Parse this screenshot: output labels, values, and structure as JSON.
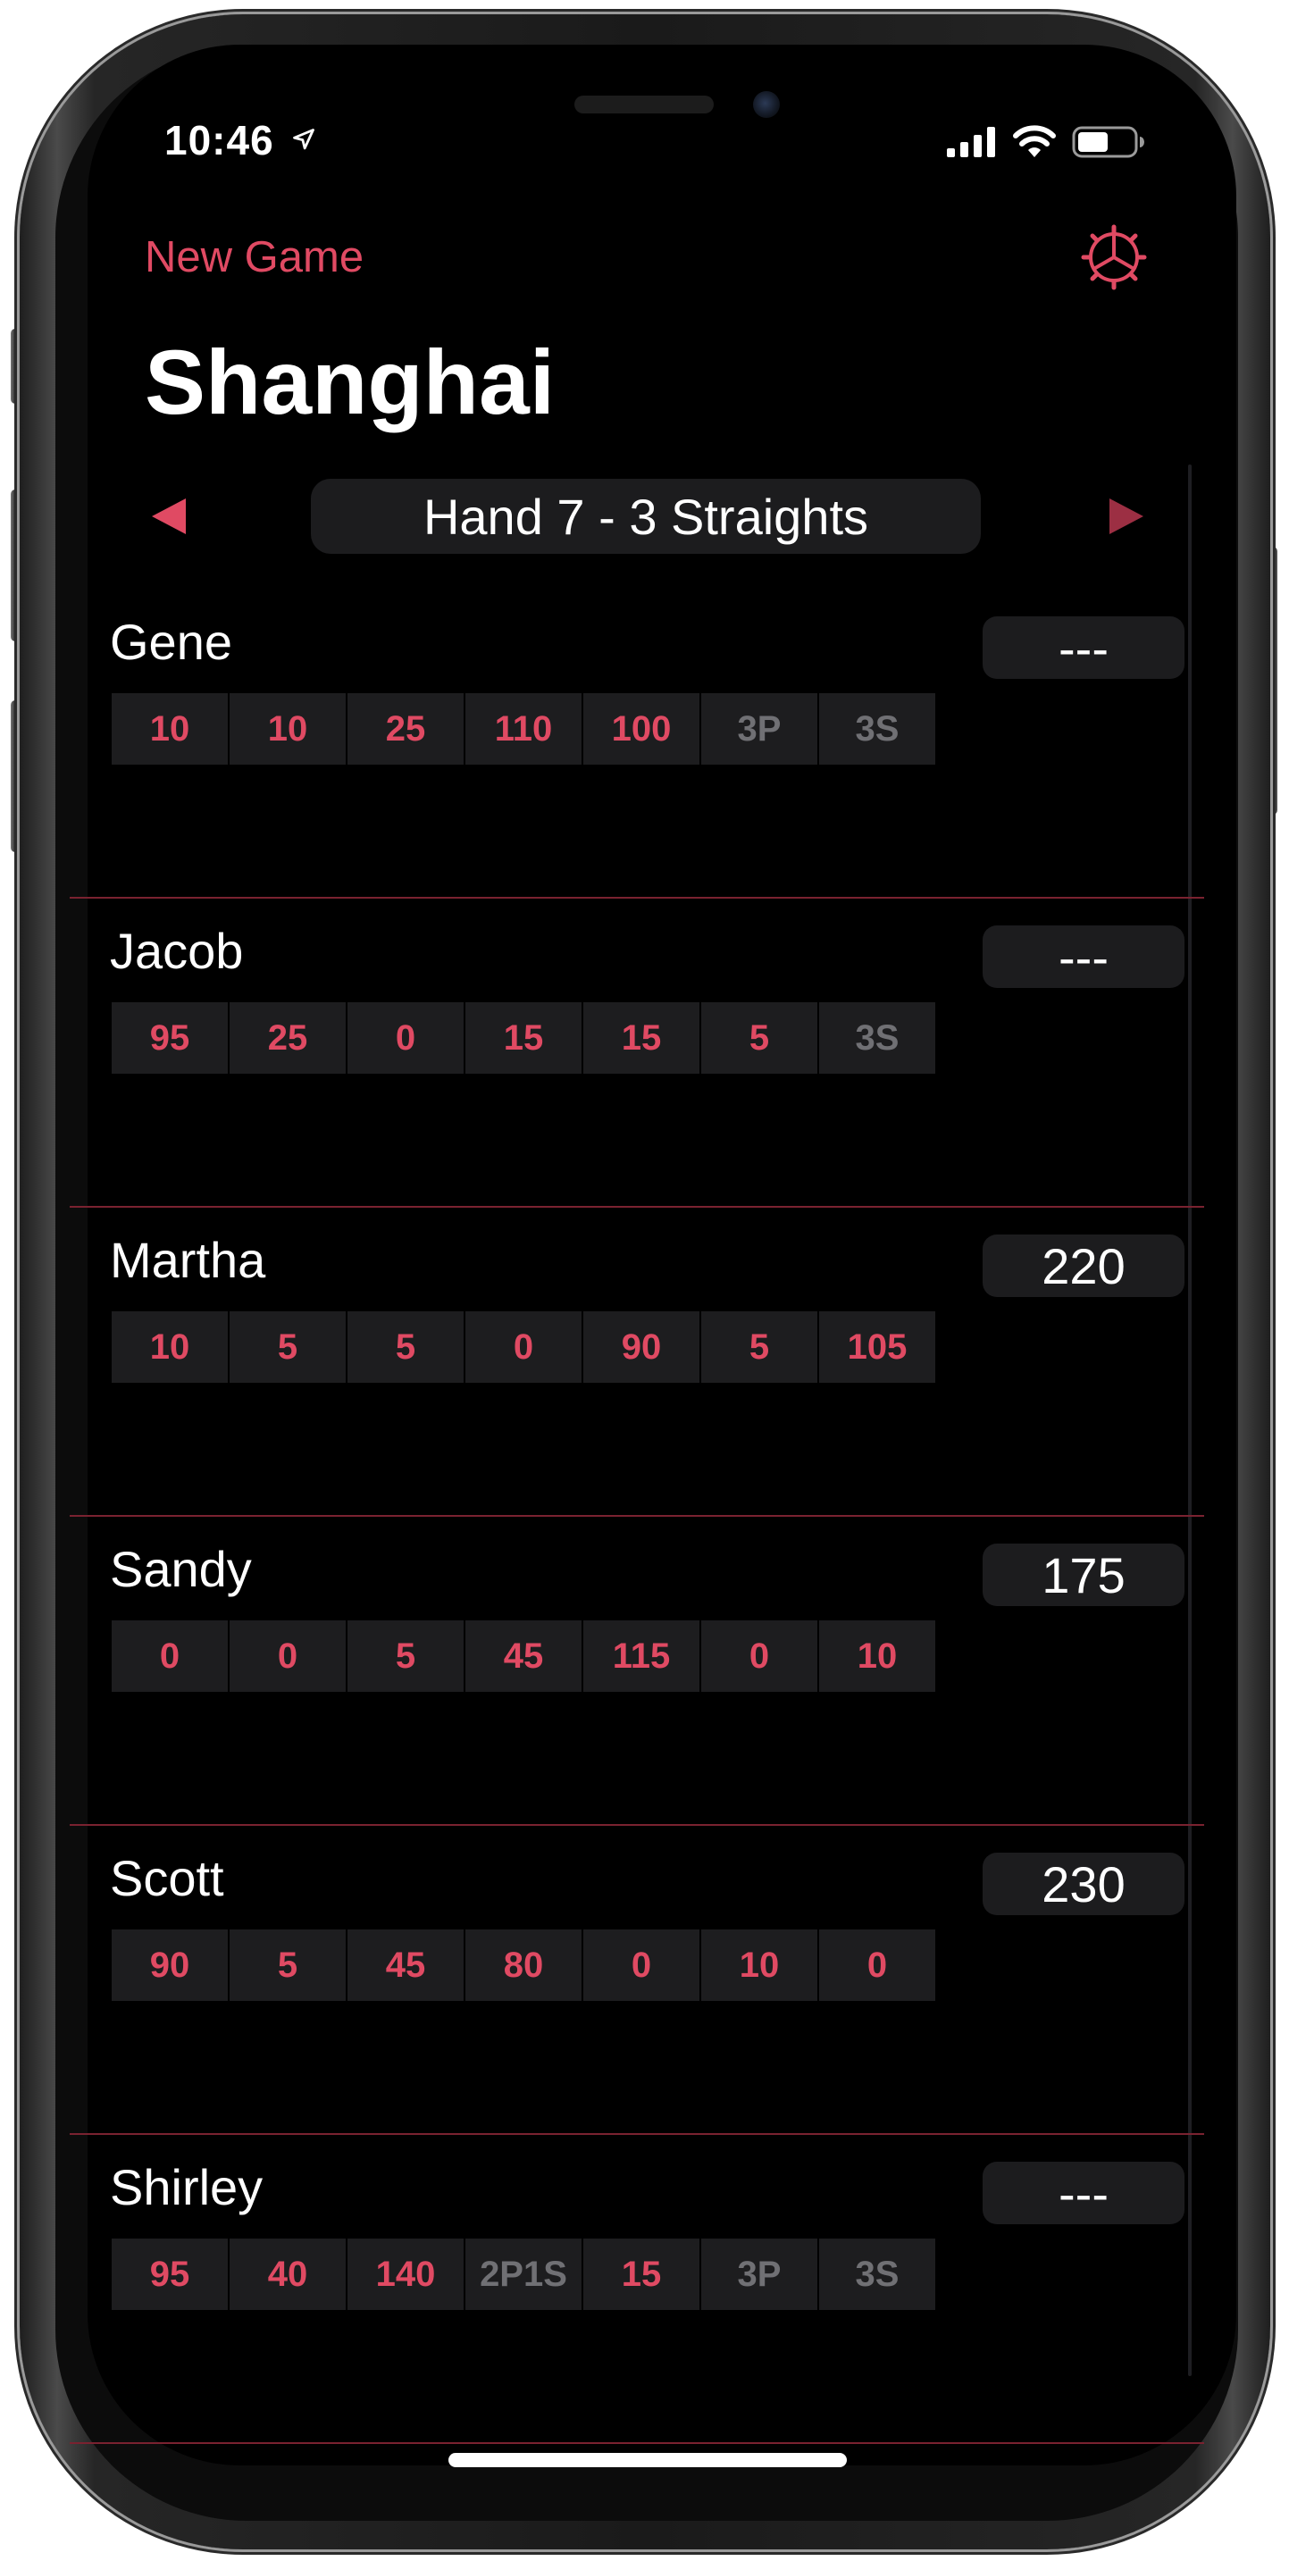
{
  "colors": {
    "accent": "#e04a63",
    "screen": "#000000",
    "surface": "#1c1c1e",
    "divider": "#7a2230",
    "pending_cell_text": "#707074"
  },
  "status_bar": {
    "time": "10:46",
    "icons": [
      "location-arrow-icon",
      "cellular-signal-icon",
      "wifi-icon",
      "battery-icon"
    ]
  },
  "nav": {
    "new_game_label": "New Game",
    "settings_icon": "gear-icon"
  },
  "title": "Shanghai",
  "hand_selector": {
    "label": "Hand 7 - 3 Straights",
    "prev_icon": "triangle-left-icon",
    "next_icon": "triangle-right-icon"
  },
  "players": [
    {
      "name": "Gene",
      "total": "---",
      "scores": [
        "10",
        "10",
        "25",
        "110",
        "100",
        "3P",
        "3S"
      ]
    },
    {
      "name": "Jacob",
      "total": "---",
      "scores": [
        "95",
        "25",
        "0",
        "15",
        "15",
        "5",
        "3S"
      ]
    },
    {
      "name": "Martha",
      "total": "220",
      "scores": [
        "10",
        "5",
        "5",
        "0",
        "90",
        "5",
        "105"
      ]
    },
    {
      "name": "Sandy",
      "total": "175",
      "scores": [
        "0",
        "0",
        "5",
        "45",
        "115",
        "0",
        "10"
      ]
    },
    {
      "name": "Scott",
      "total": "230",
      "scores": [
        "90",
        "5",
        "45",
        "80",
        "0",
        "10",
        "0"
      ]
    },
    {
      "name": "Shirley",
      "total": "---",
      "scores": [
        "95",
        "40",
        "140",
        "2P1S",
        "15",
        "3P",
        "3S"
      ]
    }
  ]
}
